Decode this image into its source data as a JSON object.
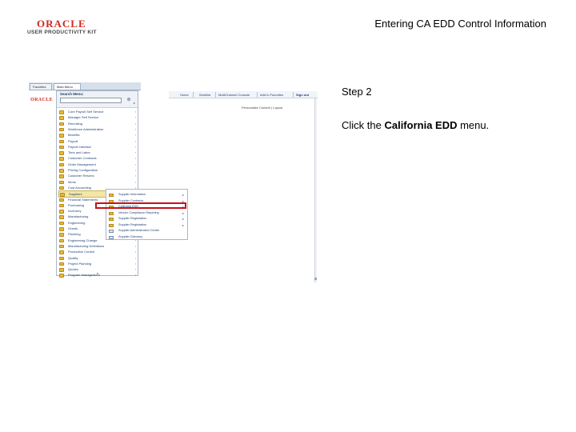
{
  "header": {
    "logo_brand": "ORACLE",
    "logo_subtitle": "USER PRODUCTIVITY KIT",
    "doc_title": "Entering CA EDD Control Information"
  },
  "screenshot": {
    "tabs": [
      "Favorites",
      "Main Menu"
    ],
    "brand_small": "ORACLE",
    "top_nav": [
      "Home",
      "Worklist",
      "MultiChannel Console",
      "Add to Favorites",
      "Sign out"
    ],
    "personalize": "Personalize Content | Layout",
    "menu": {
      "title": "Search Menu:",
      "search_value": "",
      "items": [
        {
          "label": "Core Payroll Self Service",
          "arrow": "›"
        },
        {
          "label": "Manager Self Service",
          "arrow": "›"
        },
        {
          "label": "Recruiting",
          "arrow": "›"
        },
        {
          "label": "Workforce Administration",
          "arrow": "›"
        },
        {
          "label": "Benefits",
          "arrow": "›"
        },
        {
          "label": "Payroll",
          "arrow": "›"
        },
        {
          "label": "Payroll Interface",
          "arrow": "›"
        },
        {
          "label": "Time and Labor",
          "arrow": "›"
        },
        {
          "label": "Customer Contracts",
          "arrow": "›"
        },
        {
          "label": "Order Management",
          "arrow": "›"
        },
        {
          "label": "Pricing Configuration",
          "arrow": "›"
        },
        {
          "label": "Customer Returns",
          "arrow": "›"
        },
        {
          "label": "Items",
          "arrow": "›"
        },
        {
          "label": "Cost Accounting",
          "arrow": "›"
        },
        {
          "label": "Suppliers",
          "arrow": "›"
        },
        {
          "label": "Financial Statements",
          "arrow": "›"
        },
        {
          "label": "Purchasing",
          "arrow": "›"
        },
        {
          "label": "Inventory",
          "arrow": "›"
        },
        {
          "label": "Manufacturing",
          "arrow": "›"
        },
        {
          "label": "Engineering",
          "arrow": "›"
        },
        {
          "label": "Grants",
          "arrow": "›"
        },
        {
          "label": "Planning",
          "arrow": "›"
        },
        {
          "label": "Engineering Change",
          "arrow": "›"
        },
        {
          "label": "Manufacturing Definitions",
          "arrow": "›"
        },
        {
          "label": "Production Control",
          "arrow": "›"
        },
        {
          "label": "Quality",
          "arrow": "›"
        },
        {
          "label": "Project Planning",
          "arrow": "›"
        },
        {
          "label": "Quotes",
          "arrow": "›"
        },
        {
          "label": "Program Management",
          "arrow": "›"
        }
      ],
      "footer_arrow": "▾"
    },
    "submenu": {
      "items": [
        {
          "label": "Supplier Information",
          "arrow": "▸",
          "page": false
        },
        {
          "label": "Supplier Contracts",
          "arrow": "▸",
          "page": false
        },
        {
          "label": "California EDD",
          "arrow": "▸",
          "page": false
        },
        {
          "label": "Vendor Compliance Reporting",
          "arrow": "▸",
          "page": false
        },
        {
          "label": "Supplier Registration",
          "arrow": "▸",
          "page": false
        },
        {
          "label": "Supplier Registration",
          "arrow": "▸",
          "page": false
        },
        {
          "label": "Supplier Administration Center",
          "arrow": "",
          "page": true
        },
        {
          "label": "Supplier Directory",
          "arrow": "",
          "page": true
        }
      ]
    }
  },
  "instructions": {
    "step": "Step 2",
    "text_prefix": "Click the ",
    "text_bold": "California EDD",
    "text_suffix": " menu."
  }
}
